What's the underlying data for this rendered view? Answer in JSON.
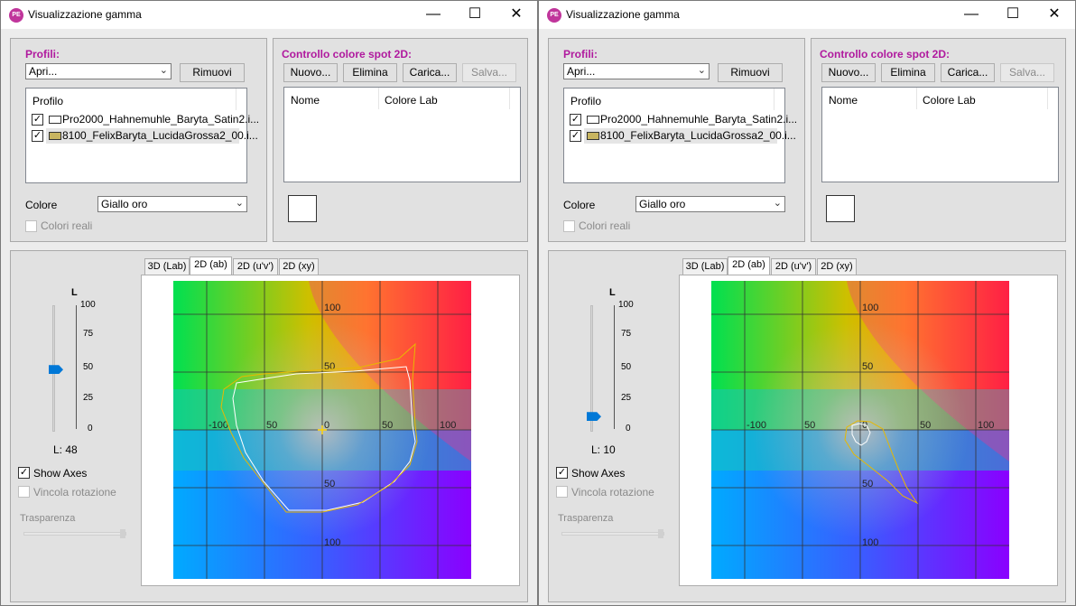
{
  "windows": [
    {
      "title": "Visualizzazione gamma",
      "app_icon_text": "PE",
      "controls": {
        "minimize": "—",
        "maximize": "☐",
        "close": "✕"
      },
      "profiles": {
        "title": "Profili:",
        "open_combo": "Apri...",
        "remove_button": "Rimuovi",
        "list_header": "Profilo",
        "rows": [
          {
            "checked": true,
            "swatch": "#ffffff",
            "text": "Pro2000_Hahnemuhle_Baryta_Satin2.i..."
          },
          {
            "checked": true,
            "swatch": "#c8b560",
            "text": "8100_FelixBaryta_LucidaGrossa2_00.i..."
          }
        ],
        "color_label": "Colore",
        "color_value": "Giallo oro",
        "real_colors_label": "Colori reali"
      },
      "spot": {
        "title": "Controllo colore spot 2D:",
        "new_button": "Nuovo...",
        "delete_button": "Elimina",
        "load_button": "Carica...",
        "save_button": "Salva...",
        "col_name": "Nome",
        "col_lab": "Colore Lab"
      },
      "view": {
        "tabs": [
          "3D (Lab)",
          "2D (ab)",
          "2D (u'v')",
          "2D (xy)"
        ],
        "active_tab": 1,
        "l_label": "L",
        "l_ticks": [
          "100",
          "75",
          "50",
          "25",
          "0"
        ],
        "l_value_text": "L: 48",
        "l_value": 48,
        "show_axes_label": "Show Axes",
        "show_axes_checked": true,
        "constrain_label": "Vincola rotazione",
        "transparency_label": "Trasparenza",
        "axis_labels": {
          "top100": "100",
          "top50": "50",
          "left100": "-100",
          "left50": "50",
          "zero": "0",
          "right50": "50",
          "right100": "100",
          "bottom50": "50",
          "bottom100": "100"
        }
      }
    },
    {
      "title": "Visualizzazione gamma",
      "app_icon_text": "PE",
      "controls": {
        "minimize": "—",
        "maximize": "☐",
        "close": "✕"
      },
      "profiles": {
        "title": "Profili:",
        "open_combo": "Apri...",
        "remove_button": "Rimuovi",
        "list_header": "Profilo",
        "rows": [
          {
            "checked": true,
            "swatch": "#ffffff",
            "text": "Pro2000_Hahnemuhle_Baryta_Satin2.i..."
          },
          {
            "checked": true,
            "swatch": "#c8b560",
            "text": "8100_FelixBaryta_LucidaGrossa2_00.i..."
          }
        ],
        "color_label": "Colore",
        "color_value": "Giallo oro",
        "real_colors_label": "Colori reali"
      },
      "spot": {
        "title": "Controllo colore spot 2D:",
        "new_button": "Nuovo...",
        "delete_button": "Elimina",
        "load_button": "Carica...",
        "save_button": "Salva...",
        "col_name": "Nome",
        "col_lab": "Colore Lab"
      },
      "view": {
        "tabs": [
          "3D (Lab)",
          "2D (ab)",
          "2D (u'v')",
          "2D (xy)"
        ],
        "active_tab": 1,
        "l_label": "L",
        "l_ticks": [
          "100",
          "75",
          "50",
          "25",
          "0"
        ],
        "l_value_text": "L: 10",
        "l_value": 10,
        "show_axes_label": "Show Axes",
        "show_axes_checked": true,
        "constrain_label": "Vincola rotazione",
        "transparency_label": "Trasparenza",
        "axis_labels": {
          "top100": "100",
          "top50": "50",
          "left100": "-100",
          "left50": "50",
          "zero": "0",
          "right50": "50",
          "right100": "100",
          "bottom50": "50",
          "bottom100": "100"
        }
      }
    }
  ],
  "colors": {
    "group_title": "#b0199e",
    "slider_accent": "#0078d7",
    "profile_a_outline": "#ffffff",
    "profile_b_outline": "#e8b800"
  }
}
